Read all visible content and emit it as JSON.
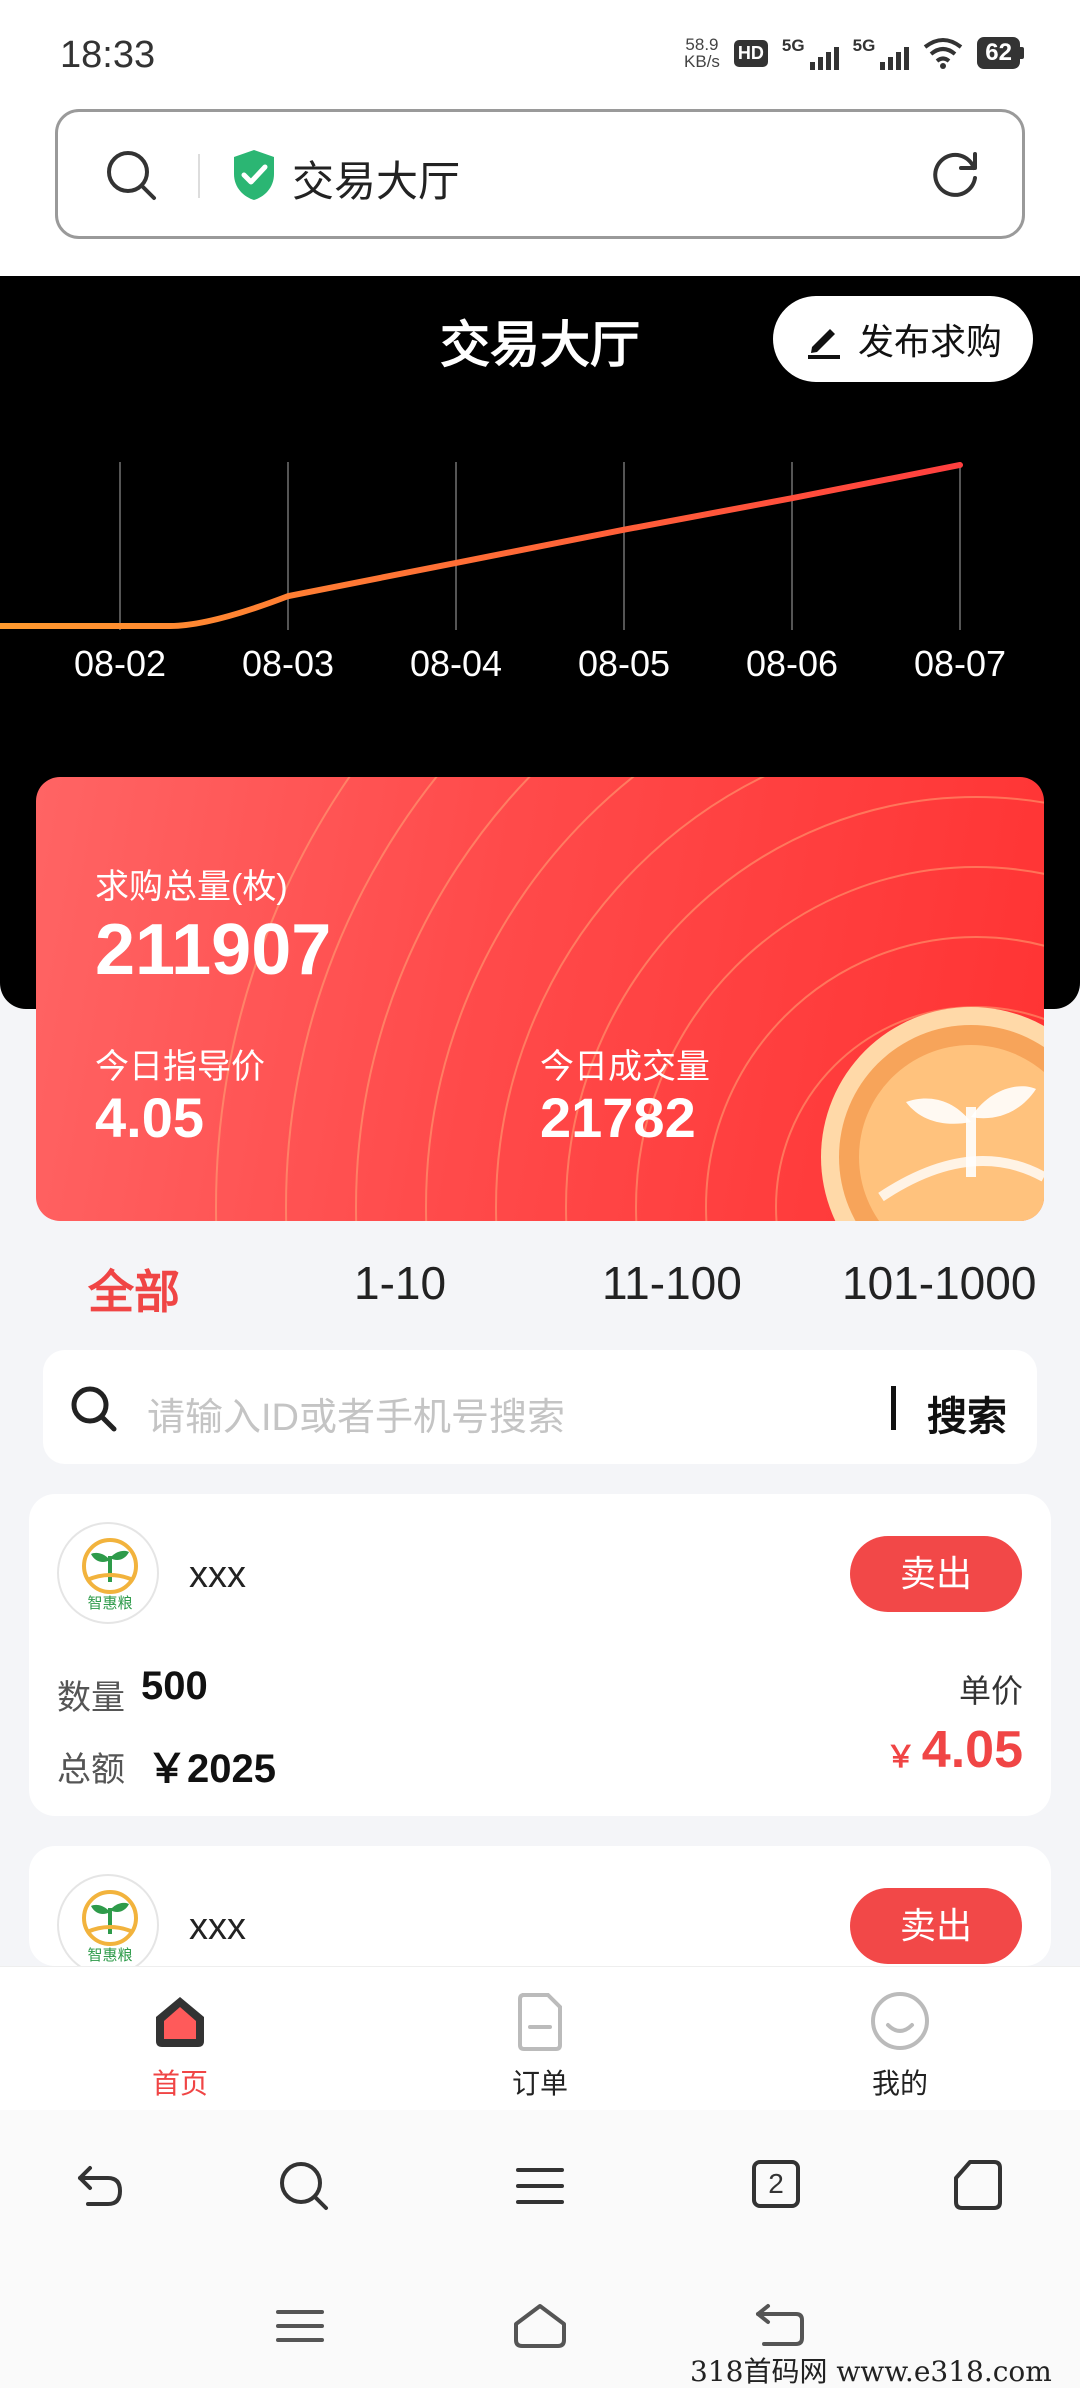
{
  "status_bar": {
    "time": "18:33",
    "net_speed_value": "58.9",
    "net_speed_unit": "KB/s",
    "hd_label": "HD",
    "sim1_label": "5G",
    "sim2_label": "5G",
    "battery": "62"
  },
  "address_bar": {
    "title": "交易大厅"
  },
  "header": {
    "title": "交易大厅",
    "publish_label": "发布求购"
  },
  "chart_data": {
    "type": "line",
    "title": "",
    "xlabel": "",
    "ylabel": "",
    "categories": [
      "08-02",
      "08-03",
      "08-04",
      "08-05",
      "08-06",
      "08-07"
    ],
    "series": [
      {
        "values": [
          0,
          18,
          38,
          58,
          77,
          97
        ]
      }
    ],
    "ylim": [
      0,
      100
    ],
    "grid": "vertical lines",
    "line_gradient": [
      "#ff9a2e",
      "#ff3f3f"
    ]
  },
  "stats": {
    "total_label": "求购总量(枚)",
    "total_value": "211907",
    "guide_price_label": "今日指导价",
    "guide_price_value": "4.05",
    "volume_label": "今日成交量",
    "volume_value": "21782"
  },
  "tabs": [
    {
      "label": "全部",
      "active": true
    },
    {
      "label": "1-10",
      "active": false
    },
    {
      "label": "11-100",
      "active": false
    },
    {
      "label": "101-1000",
      "active": false
    }
  ],
  "search": {
    "placeholder": "请输入ID或者手机号搜索",
    "button": "搜索"
  },
  "orders": [
    {
      "logo_text": "智惠粮",
      "name": "xxx",
      "action": "卖出",
      "qty_label": "数量",
      "qty": "500",
      "total_label": "总额",
      "total": "￥2025",
      "price_label": "单价",
      "currency": "￥",
      "price": "4.05"
    },
    {
      "logo_text": "智惠粮",
      "name": "xxx",
      "action": "卖出"
    }
  ],
  "tabbar": [
    {
      "label": "首页",
      "icon": "home-icon",
      "active": true
    },
    {
      "label": "订单",
      "icon": "order-icon",
      "active": false
    },
    {
      "label": "我的",
      "icon": "profile-icon",
      "active": false
    }
  ],
  "browser_toolbar": {
    "tab_count": "2"
  },
  "watermark": "318首码网   www.e318.com",
  "colors": {
    "accent_red": "#f04545",
    "card_red": "#ff4a4a",
    "trend_start": "#ff9a2e",
    "trend_end": "#ff3f3f",
    "shield_green": "#2bb673"
  }
}
